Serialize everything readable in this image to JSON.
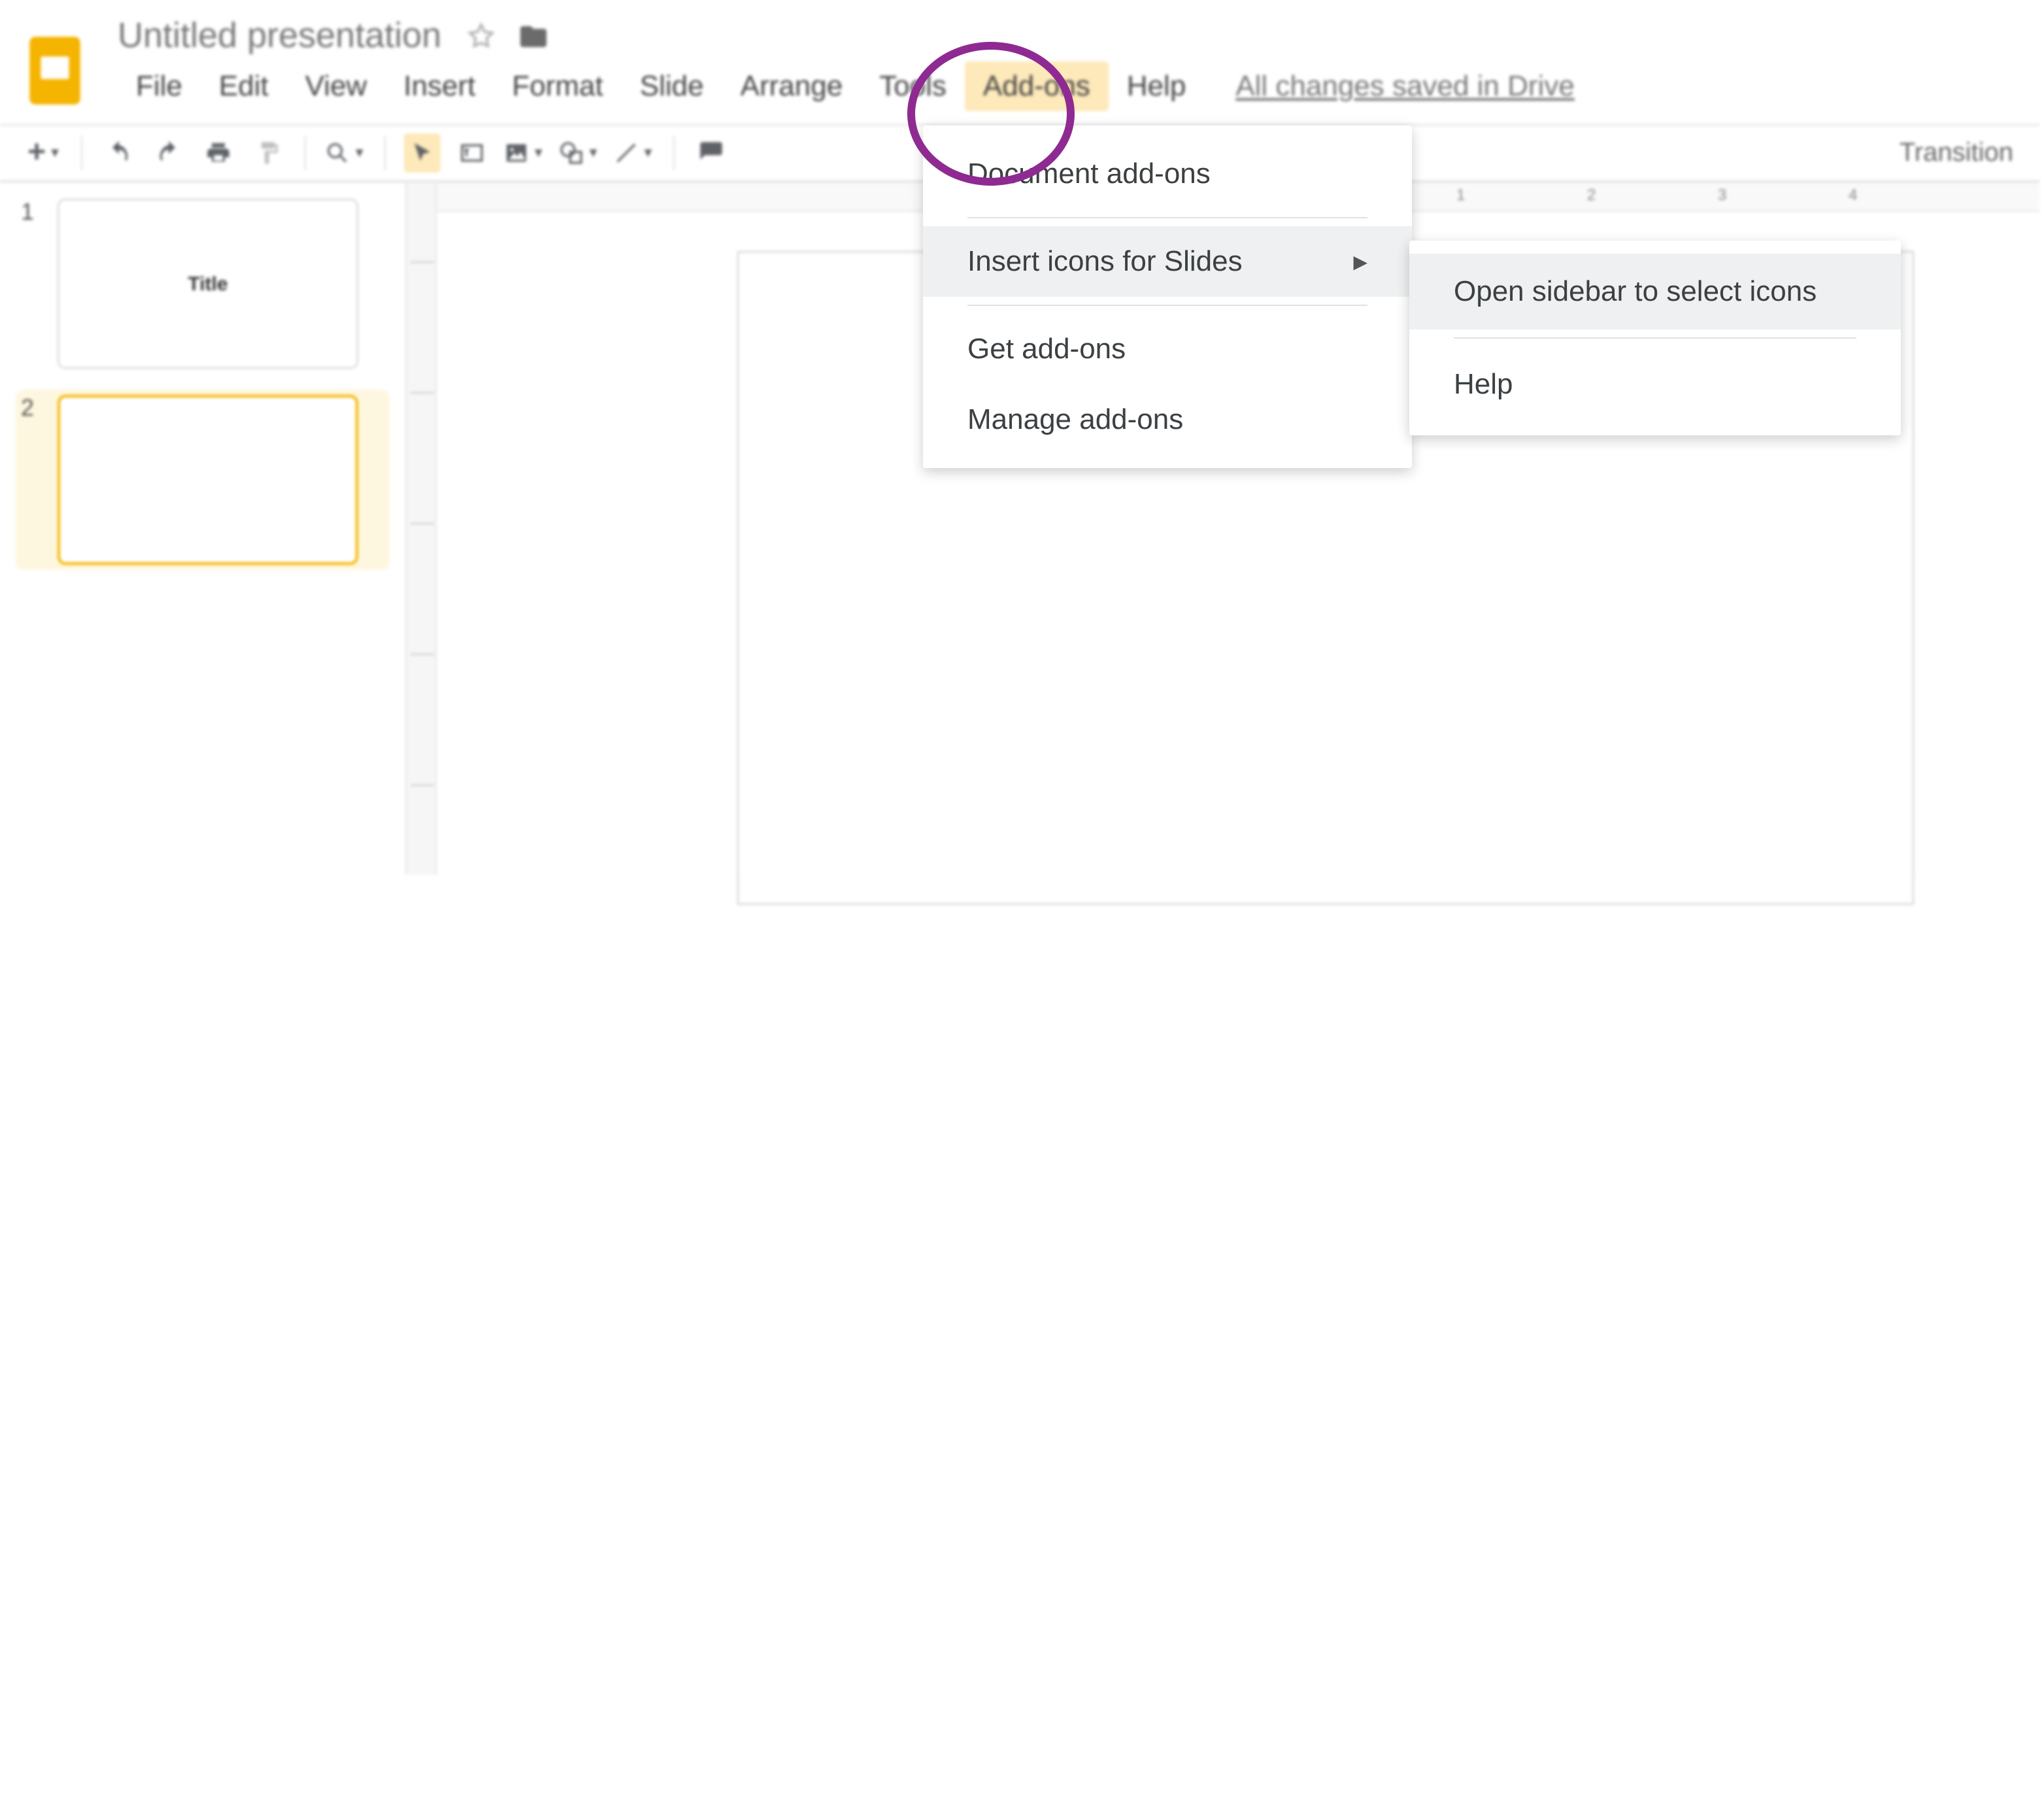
{
  "header": {
    "app_icon": "slides-icon",
    "doc_title": "Untitled presentation",
    "saved_text": "All changes saved in Drive"
  },
  "menus": {
    "items": [
      "File",
      "Edit",
      "View",
      "Insert",
      "Format",
      "Slide",
      "Arrange",
      "Tools",
      "Add-ons",
      "Help"
    ],
    "active_index": 8
  },
  "toolbar": {
    "transition_label": "Transition"
  },
  "dropdown": {
    "items": [
      {
        "label": "Document add-ons",
        "hover": false,
        "submenu": false
      },
      {
        "label": "Insert icons for Slides",
        "hover": true,
        "submenu": true
      },
      {
        "label": "Get add-ons",
        "hover": false,
        "submenu": false
      },
      {
        "label": "Manage add-ons",
        "hover": false,
        "submenu": false
      }
    ]
  },
  "submenu": {
    "items": [
      {
        "label": "Open sidebar to select icons",
        "hover": true
      },
      {
        "label": "Help",
        "hover": false
      }
    ]
  },
  "thumbnails": {
    "slides": [
      {
        "num": "1",
        "title": "Title",
        "selected": false
      },
      {
        "num": "2",
        "title": "",
        "selected": true
      }
    ]
  },
  "ruler": {
    "labels": [
      "1",
      "2",
      "3",
      "4"
    ]
  }
}
